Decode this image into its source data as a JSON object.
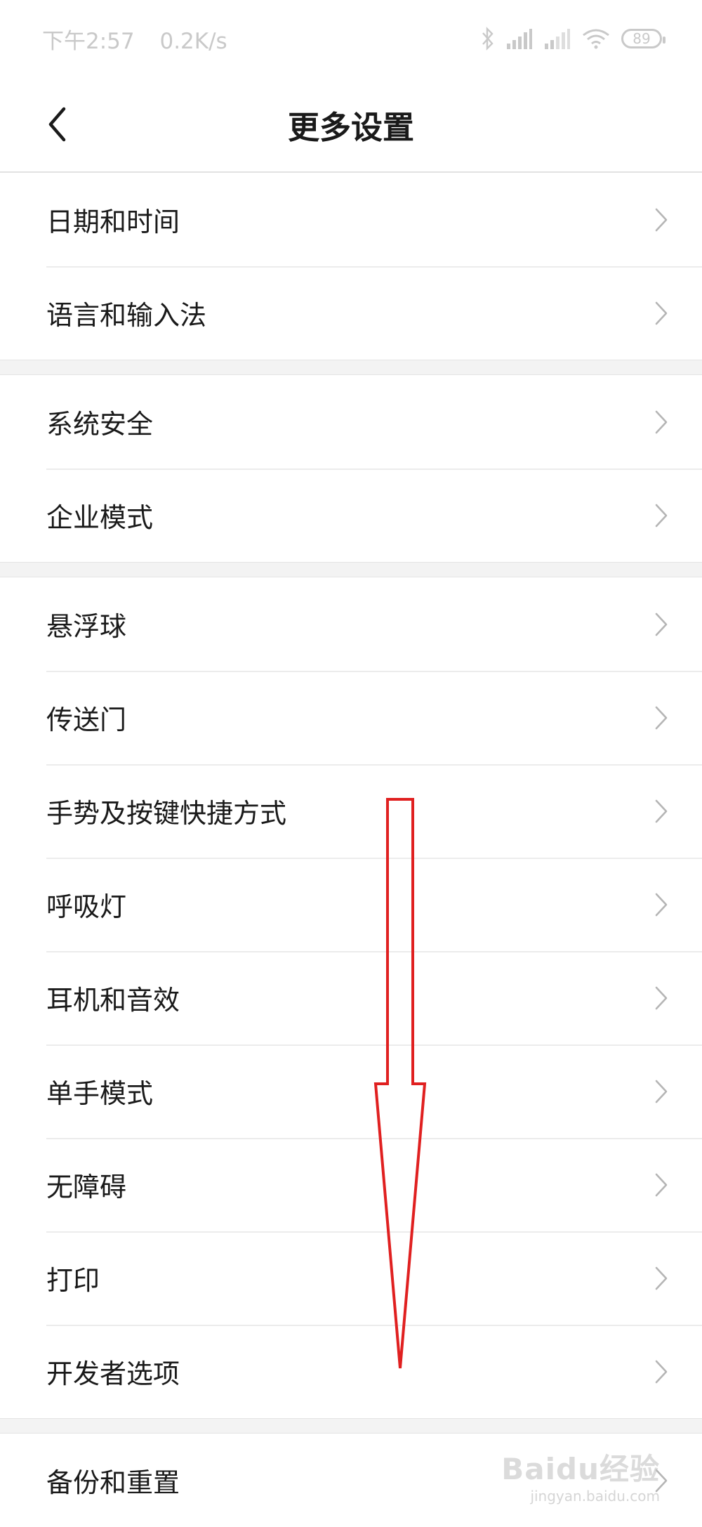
{
  "status_bar": {
    "time": "下午2:57",
    "network_speed": "0.2K/s",
    "battery_level": "89",
    "icons": [
      "bluetooth-icon",
      "signal-icon",
      "signal-icon",
      "wifi-icon",
      "battery-icon"
    ]
  },
  "header": {
    "title": "更多设置",
    "back_icon": "chevron-left-icon"
  },
  "groups": [
    {
      "items": [
        {
          "label": "日期和时间"
        },
        {
          "label": "语言和输入法"
        }
      ]
    },
    {
      "items": [
        {
          "label": "系统安全"
        },
        {
          "label": "企业模式"
        }
      ]
    },
    {
      "items": [
        {
          "label": "悬浮球"
        },
        {
          "label": "传送门"
        },
        {
          "label": "手势及按键快捷方式"
        },
        {
          "label": "呼吸灯"
        },
        {
          "label": "耳机和音效"
        },
        {
          "label": "单手模式"
        },
        {
          "label": "无障碍"
        },
        {
          "label": "打印"
        },
        {
          "label": "开发者选项"
        }
      ]
    },
    {
      "items": [
        {
          "label": "备份和重置"
        }
      ]
    }
  ],
  "annotation": {
    "arrow_color": "#e02020",
    "direction": "down"
  },
  "watermark": {
    "brand": "Baidu经验",
    "url": "jingyan.baidu.com"
  },
  "colors": {
    "chevron": "#b5b5b5",
    "status_text": "#c9c9c9",
    "group_gap": "#f3f3f3"
  }
}
